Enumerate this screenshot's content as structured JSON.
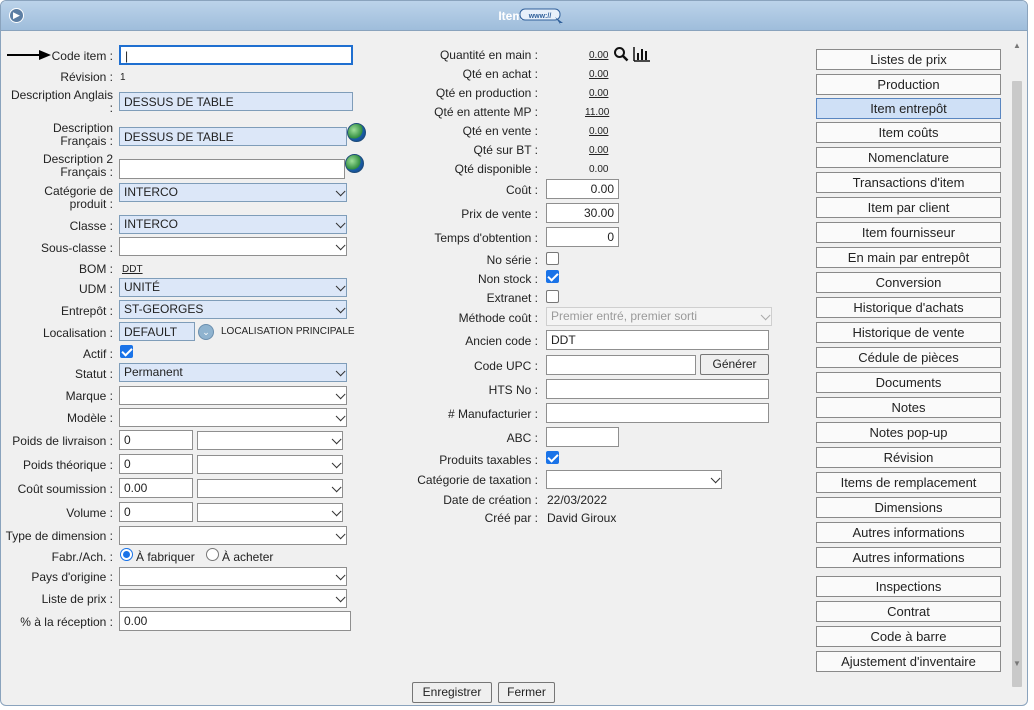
{
  "window": {
    "title": "Items"
  },
  "icons": {
    "nav": "circle-arrow-right-icon",
    "web": "www-link-icon",
    "globe": "globe-icon",
    "search": "search-icon",
    "chart": "bar-chart-icon",
    "dropdown": "circle-chevron-down-icon",
    "pointer": "arrow-pointer-icon"
  },
  "left": {
    "code_item_label": "Code item :",
    "code_item_value": "|",
    "revision_label": "Révision :",
    "revision_value": "1",
    "desc_en_label": "Description Anglais :",
    "desc_en_value": "DESSUS DE TABLE",
    "desc_fr_label": "Description Français :",
    "desc_fr_value": "DESSUS DE TABLE",
    "desc2_fr_label": "Description 2 Français :",
    "desc2_fr_value": "",
    "categorie_label": "Catégorie de produit :",
    "categorie_value": "INTERCO",
    "classe_label": "Classe :",
    "classe_value": "INTERCO",
    "sous_classe_label": "Sous-classe :",
    "sous_classe_value": "",
    "bom_label": "BOM :",
    "bom_value": "DDT",
    "udm_label": "UDM :",
    "udm_value": "UNITÉ",
    "entrepot_label": "Entrepôt :",
    "entrepot_value": "ST-GEORGES",
    "localisation_label": "Localisation :",
    "localisation_value": "DEFAULT",
    "localisation_desc": "LOCALISATION PRINCIPALE",
    "actif_label": "Actif :",
    "statut_label": "Statut :",
    "statut_value": "Permanent",
    "marque_label": "Marque :",
    "modele_label": "Modèle :",
    "poids_livraison_label": "Poids de livraison :",
    "poids_livraison_value": "0",
    "poids_theorique_label": "Poids théorique :",
    "poids_theorique_value": "0",
    "cout_soumission_label": "Coût soumission :",
    "cout_soumission_value": "0.00",
    "volume_label": "Volume :",
    "volume_value": "0",
    "type_dimension_label": "Type de dimension :",
    "fabr_label": "Fabr./Ach. :",
    "fabr_option1": "À fabriquer",
    "fabr_option2": "À acheter",
    "pays_label": "Pays d'origine :",
    "liste_prix_label": "Liste de prix :",
    "pct_reception_label": "% à la réception :",
    "pct_reception_value": "0.00"
  },
  "middle": {
    "qte_main_label": "Quantité en main :",
    "qte_main_value": "0.00",
    "qte_achat_label": "Qté en achat :",
    "qte_achat_value": "0.00",
    "qte_production_label": "Qté en production :",
    "qte_production_value": "0.00",
    "qte_attente_label": "Qté en attente MP :",
    "qte_attente_value": "11.00",
    "qte_vente_label": "Qté en vente :",
    "qte_vente_value": "0.00",
    "qte_bt_label": "Qté sur BT :",
    "qte_bt_value": "0.00",
    "qte_dispo_label": "Qté disponible :",
    "qte_dispo_value": "0.00",
    "cout_label": "Coût :",
    "cout_value": "0.00",
    "prix_vente_label": "Prix de vente :",
    "prix_vente_value": "30.00",
    "temps_label": "Temps d'obtention :",
    "temps_value": "0",
    "no_serie_label": "No série :",
    "non_stock_label": "Non stock :",
    "extranet_label": "Extranet :",
    "methode_label": "Méthode coût :",
    "methode_value": "Premier entré, premier sorti",
    "ancien_code_label": "Ancien code :",
    "ancien_code_value": "DDT",
    "upc_label": "Code UPC :",
    "upc_value": "",
    "generer_label": "Générer",
    "hts_label": "HTS No :",
    "manufacturier_label": "# Manufacturier :",
    "abc_label": "ABC :",
    "produits_taxables_label": "Produits taxables :",
    "categorie_taxation_label": "Catégorie de taxation :",
    "date_creation_label": "Date de création :",
    "date_creation_value": "22/03/2022",
    "cree_par_label": "Créé par :",
    "cree_par_value": "David Giroux"
  },
  "sidebar": {
    "items": [
      {
        "label": "Listes de prix",
        "active": false
      },
      {
        "label": "Production",
        "active": false
      },
      {
        "label": "Item entrepôt",
        "active": true
      },
      {
        "label": "Item coûts",
        "active": false
      },
      {
        "label": "Nomenclature",
        "active": false
      },
      {
        "label": "Transactions d'item",
        "active": false
      },
      {
        "label": "Item par client",
        "active": false
      },
      {
        "label": "Item fournisseur",
        "active": false
      },
      {
        "label": "En main par entrepôt",
        "active": false
      },
      {
        "label": "Conversion",
        "active": false
      },
      {
        "label": "Historique d'achats",
        "active": false
      },
      {
        "label": "Historique de vente",
        "active": false
      },
      {
        "label": "Cédule de pièces",
        "active": false
      },
      {
        "label": "Documents",
        "active": false
      },
      {
        "label": "Notes",
        "active": false
      },
      {
        "label": "Notes pop-up",
        "active": false
      },
      {
        "label": "Révision",
        "active": false
      },
      {
        "label": "Items de remplacement",
        "active": false
      },
      {
        "label": "Dimensions",
        "active": false
      },
      {
        "label": "Autres informations",
        "active": false
      },
      {
        "label": "Autres informations",
        "active": false
      },
      {
        "label": "Inspections",
        "active": false
      },
      {
        "label": "Contrat",
        "active": false
      },
      {
        "label": "Code à barre",
        "active": false
      },
      {
        "label": "Ajustement d'inventaire",
        "active": false
      }
    ]
  },
  "footer": {
    "save_label": "Enregistrer",
    "close_label": "Fermer"
  },
  "colors": {
    "titlebar": "#a9c5e3",
    "field_blue": "#dce7f8",
    "active_tab": "#cfe0f6",
    "check": "#1a73e8"
  }
}
